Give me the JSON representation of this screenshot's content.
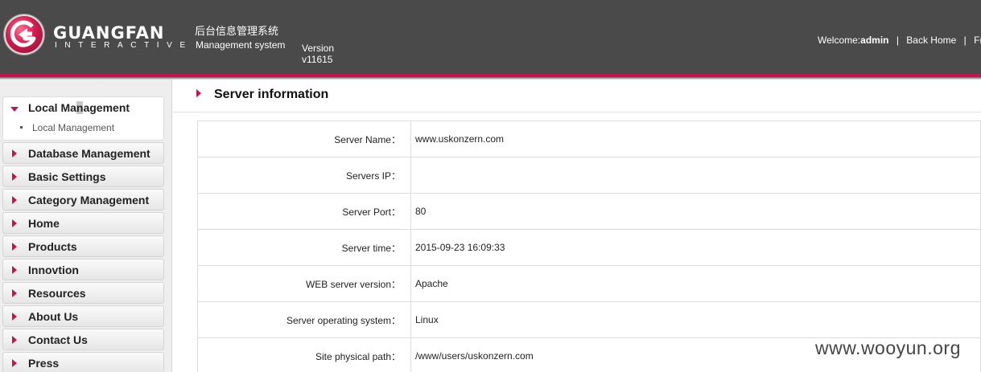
{
  "header": {
    "brand_name": "GUANGFAN",
    "brand_subtitle": "INTERACTIVE",
    "system_name_cn": "后台信息管理系统",
    "system_name_en": "Management system",
    "version_label": "Version",
    "version_value": "v11615",
    "welcome_prefix": "Welcome:",
    "username": "admin",
    "separator": "|",
    "back_home": "Back Home",
    "extra_link": "Fr"
  },
  "sidebar": {
    "open_section": {
      "title_before": "Local Ma",
      "title_highlight": "n",
      "title_after": "agement",
      "sub_item": "Local Management"
    },
    "items": [
      {
        "label": "Database Management"
      },
      {
        "label": "Basic Settings"
      },
      {
        "label": "Category Management"
      },
      {
        "label": "Home"
      },
      {
        "label": "Products"
      },
      {
        "label": "Innovtion"
      },
      {
        "label": "Resources"
      },
      {
        "label": "About Us"
      },
      {
        "label": "Contact Us"
      },
      {
        "label": "Press"
      }
    ]
  },
  "content": {
    "title": "Server information",
    "rows": [
      {
        "label": "Server Name：",
        "value": "www.uskonzern.com"
      },
      {
        "label": "Servers IP：",
        "value": ""
      },
      {
        "label": "Server Port：",
        "value": "80"
      },
      {
        "label": "Server time：",
        "value": "2015-09-23 16:09:33"
      },
      {
        "label": "WEB server version：",
        "value": "Apache"
      },
      {
        "label": "Server operating system：",
        "value": "Linux"
      },
      {
        "label": "Site physical path：",
        "value": "/www/users/uskonzern.com"
      }
    ]
  },
  "watermark": "www.wooyun.org",
  "colors": {
    "accent": "#c8104f",
    "header_bg": "#4a4a4a"
  }
}
